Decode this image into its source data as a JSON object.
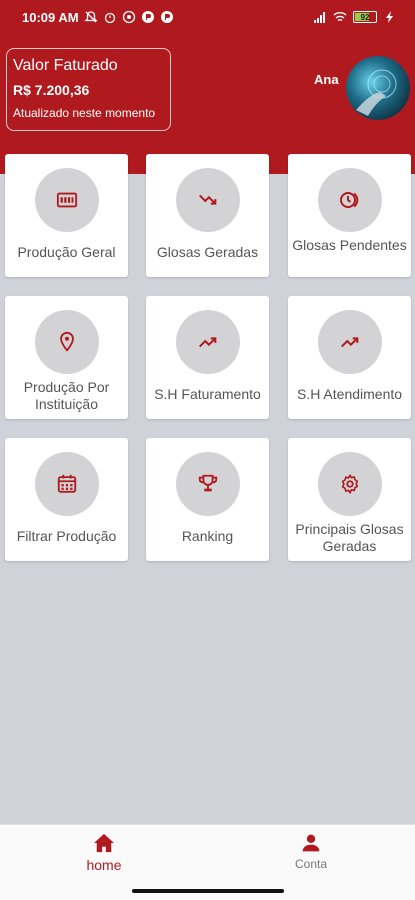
{
  "status_bar": {
    "time": "10:09 AM",
    "battery": "92"
  },
  "header": {
    "billing_title": "Valor Faturado",
    "billing_value": "R$ 7.200,36",
    "billing_updated": "Atualizado neste momento",
    "user_name": "Ana"
  },
  "tiles": [
    {
      "label": "Produção Geral",
      "icon": "production-report-icon"
    },
    {
      "label": "Glosas Geradas",
      "icon": "trending-down-icon"
    },
    {
      "label": "Glosas Pendentes",
      "icon": "pending-clock-icon"
    },
    {
      "label": "Produção Por Instituição",
      "icon": "location-pin-icon"
    },
    {
      "label": "S.H Faturamento",
      "icon": "trending-up-icon"
    },
    {
      "label": "S.H Atendimento",
      "icon": "trending-up-icon"
    },
    {
      "label": "Filtrar Produção",
      "icon": "calendar-icon"
    },
    {
      "label": "Ranking",
      "icon": "trophy-icon"
    },
    {
      "label": "Principais Glosas Geradas",
      "icon": "gear-icon"
    }
  ],
  "bottom_nav": {
    "home": "home",
    "account": "Conta"
  },
  "colors": {
    "brand": "#b01a1f",
    "background": "#cfd2d9",
    "icon_circle": "#d3d3d6"
  }
}
